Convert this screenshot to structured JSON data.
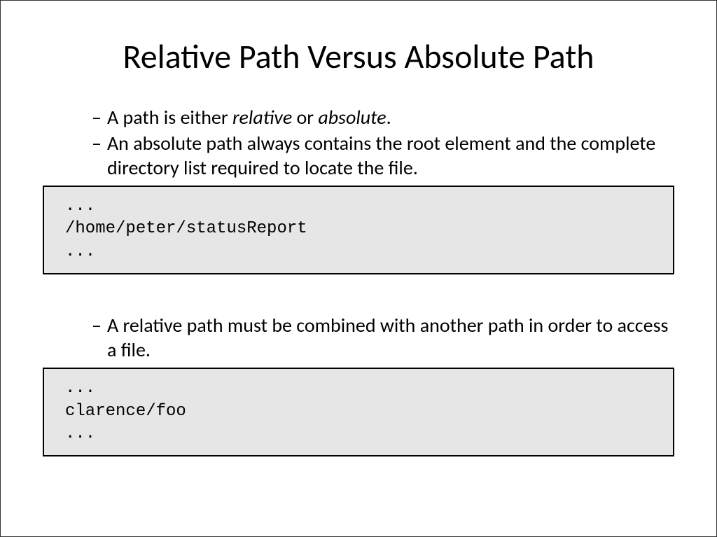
{
  "title": "Relative Path Versus Absolute Path",
  "bullets": {
    "b1_pre": "A path is either ",
    "b1_rel": "relative",
    "b1_or": " or ",
    "b1_abs": "absolute",
    "b1_post": ".",
    "b2": "An absolute path always contains the root element and the complete directory list required to locate the file.",
    "b3": "A relative path must be combined with another path in order to access a file."
  },
  "code1": {
    "line1": "...",
    "line2": "/home/peter/statusReport",
    "line3": "..."
  },
  "code2": {
    "line1": "...",
    "line2": "clarence/foo",
    "line3": "..."
  }
}
